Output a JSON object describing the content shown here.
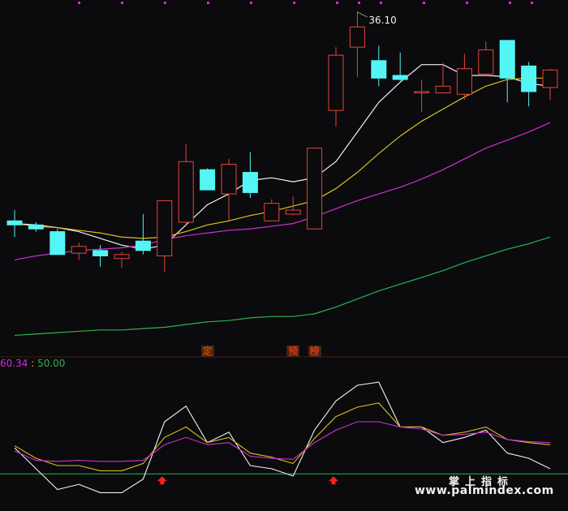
{
  "colors": {
    "background": "#0b0a0d",
    "up_candle": "#e2473a",
    "down_candle": "#54f5f5",
    "ma5": "#f2f2f2",
    "ma10": "#d9c21c",
    "ma20": "#d22fd6",
    "ma60": "#2fb34a",
    "k_line": "#f2f2f2",
    "d_line": "#d9c21c",
    "j_line": "#d22fd6",
    "baseline": "#2fb34a",
    "signal_arrow": "#ff2020",
    "divider": "#4a1818",
    "top_dot": "#d22fd6"
  },
  "chart_data": [
    {
      "type": "candlestick",
      "y_range": [
        10.5,
        37.0
      ],
      "grid": false,
      "annotations": [
        {
          "text": "36.10",
          "at_candle": 16,
          "value": 36.1
        }
      ],
      "candles": [
        {
          "open": 20.6,
          "close": 20.3,
          "high": 21.4,
          "low": 19.4
        },
        {
          "open": 20.3,
          "close": 20.0,
          "high": 20.5,
          "low": 19.8
        },
        {
          "open": 19.8,
          "close": 18.1,
          "high": 20.0,
          "low": 18.1
        },
        {
          "open": 18.2,
          "close": 18.7,
          "high": 19.0,
          "low": 17.7
        },
        {
          "open": 18.4,
          "close": 18.0,
          "high": 18.8,
          "low": 17.2
        },
        {
          "open": 17.8,
          "close": 18.1,
          "high": 18.3,
          "low": 17.1
        },
        {
          "open": 19.1,
          "close": 18.4,
          "high": 21.1,
          "low": 18.1
        },
        {
          "open": 18.0,
          "close": 22.1,
          "high": 22.1,
          "low": 16.8
        },
        {
          "open": 20.5,
          "close": 25.0,
          "high": 26.3,
          "low": 20.3
        },
        {
          "open": 24.4,
          "close": 22.9,
          "high": 24.5,
          "low": 22.9
        },
        {
          "open": 22.6,
          "close": 24.8,
          "high": 25.2,
          "low": 20.6
        },
        {
          "open": 24.2,
          "close": 22.7,
          "high": 25.7,
          "low": 22.3
        },
        {
          "open": 20.6,
          "close": 21.9,
          "high": 22.2,
          "low": 20.6
        },
        {
          "open": 21.1,
          "close": 21.4,
          "high": 22.4,
          "low": 21.0
        },
        {
          "open": 20.0,
          "close": 26.0,
          "high": 26.0,
          "low": 20.0
        },
        {
          "open": 28.8,
          "close": 32.9,
          "high": 33.5,
          "low": 27.6
        },
        {
          "open": 33.5,
          "close": 35.0,
          "high": 36.1,
          "low": 31.3
        },
        {
          "open": 32.5,
          "close": 31.2,
          "high": 33.6,
          "low": 30.6
        },
        {
          "open": 31.4,
          "close": 31.1,
          "high": 33.1,
          "low": 31.0
        },
        {
          "open": 30.1,
          "close": 30.2,
          "high": 31.1,
          "low": 28.7
        },
        {
          "open": 30.1,
          "close": 30.6,
          "high": 32.3,
          "low": 30.1
        },
        {
          "open": 30.0,
          "close": 31.9,
          "high": 33.0,
          "low": 29.6
        },
        {
          "open": 31.5,
          "close": 33.3,
          "high": 33.9,
          "low": 31.4
        },
        {
          "open": 34.0,
          "close": 31.2,
          "high": 34.0,
          "low": 29.4
        },
        {
          "open": 32.1,
          "close": 30.2,
          "high": 32.4,
          "low": 29.1
        },
        {
          "open": 30.5,
          "close": 31.8,
          "high": 31.9,
          "low": 29.6
        }
      ],
      "ma_series": [
        {
          "key": "ma5",
          "values": [
            20.4,
            20.3,
            20.1,
            19.8,
            19.3,
            18.8,
            18.5,
            18.8,
            20.3,
            21.8,
            22.6,
            23.6,
            23.8,
            23.5,
            23.8,
            25.0,
            27.2,
            29.4,
            30.9,
            32.2,
            32.2,
            31.4,
            31.4,
            31.3,
            30.8,
            30.6
          ]
        },
        {
          "key": "ma10",
          "values": [
            20.4,
            20.2,
            20.1,
            19.9,
            19.7,
            19.4,
            19.3,
            19.4,
            19.8,
            20.3,
            20.6,
            21.0,
            21.3,
            21.7,
            22.1,
            23.0,
            24.2,
            25.6,
            26.9,
            28.0,
            28.9,
            29.8,
            30.6,
            31.1,
            31.2,
            31.2
          ]
        },
        {
          "key": "ma20",
          "values": [
            17.7,
            18.0,
            18.2,
            18.4,
            18.5,
            18.6,
            18.8,
            19.2,
            19.5,
            19.7,
            19.9,
            20.0,
            20.2,
            20.4,
            20.9,
            21.5,
            22.1,
            22.6,
            23.1,
            23.7,
            24.4,
            25.2,
            26.0,
            26.6,
            27.2,
            27.9
          ]
        },
        {
          "key": "ma60",
          "values": [
            12.1,
            12.2,
            12.3,
            12.4,
            12.5,
            12.5,
            12.6,
            12.7,
            12.9,
            13.1,
            13.2,
            13.4,
            13.5,
            13.5,
            13.7,
            14.2,
            14.8,
            15.4,
            15.9,
            16.4,
            16.9,
            17.5,
            18.0,
            18.5,
            18.9,
            19.4
          ]
        }
      ],
      "signals": [
        {
          "text": "定",
          "at_candle": 9
        },
        {
          "text": "预",
          "at_candle": 13
        },
        {
          "text": "榜",
          "at_candle": 14
        }
      ]
    },
    {
      "type": "line",
      "readout": {
        "first": "60.34",
        "sep": ":",
        "second": "50.00"
      },
      "y_range": [
        -20,
        120
      ],
      "baseline": 0,
      "series": [
        {
          "key": "k_line",
          "values": [
            25,
            5,
            -15,
            -10,
            -18,
            -18,
            -5,
            50,
            65,
            30,
            40,
            8,
            5,
            -2,
            42,
            70,
            85,
            88,
            45,
            45,
            30,
            35,
            42,
            20,
            15,
            5
          ]
        },
        {
          "key": "d_line",
          "values": [
            27,
            15,
            8,
            8,
            3,
            3,
            10,
            35,
            45,
            30,
            35,
            20,
            16,
            10,
            34,
            55,
            64,
            68,
            45,
            45,
            37,
            40,
            45,
            33,
            30,
            28
          ]
        },
        {
          "key": "j_line",
          "values": [
            22,
            13,
            12,
            13,
            12,
            12,
            13,
            28,
            35,
            28,
            30,
            17,
            15,
            14,
            30,
            42,
            50,
            50,
            45,
            43,
            37,
            38,
            40,
            33,
            31,
            30
          ]
        }
      ],
      "signals": [
        {
          "at_candle": 7
        },
        {
          "at_candle": 15
        }
      ]
    }
  ],
  "watermark": {
    "title": "掌上指标",
    "url": "www.palmindex.com"
  }
}
